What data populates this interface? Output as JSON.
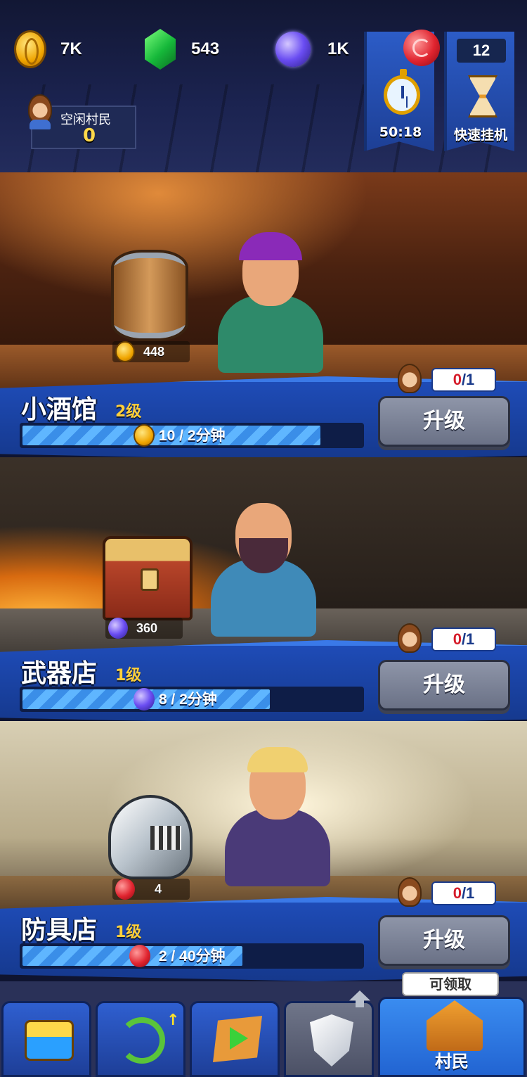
{
  "resources": {
    "gold": "7K",
    "gems": "543",
    "essence": "1K",
    "candy": "12"
  },
  "idle_villagers": {
    "label": "空闲村民",
    "count": "0"
  },
  "timer_button": {
    "label": "50:18",
    "icon": "stopwatch-icon"
  },
  "quick_idle_button": {
    "label": "快速挂机",
    "icon": "hourglass-icon"
  },
  "buildings": [
    {
      "name": "小酒馆",
      "level": "2级",
      "stock": "448",
      "resource": "gold",
      "production": "10 / 2分钟",
      "progress": 0.88,
      "workers_current": "0",
      "workers_max": "/1",
      "upgrade_label": "升级"
    },
    {
      "name": "武器店",
      "level": "1级",
      "stock": "360",
      "resource": "essence",
      "production": "8 / 2分钟",
      "progress": 0.73,
      "workers_current": "0",
      "workers_max": "/1",
      "upgrade_label": "升级"
    },
    {
      "name": "防具店",
      "level": "1级",
      "stock": "4",
      "resource": "candy",
      "production": "2 / 40分钟",
      "progress": 0.65,
      "workers_current": "0",
      "workers_max": "/1",
      "upgrade_label": "升级"
    }
  ],
  "nav": {
    "items": [
      {
        "icon": "treasure-chest-icon"
      },
      {
        "icon": "bow-upgrade-icon"
      },
      {
        "icon": "map-play-icon"
      },
      {
        "icon": "shield-locked-icon"
      },
      {
        "icon": "village-house-icon",
        "label": "村民",
        "active": true
      }
    ],
    "claim_tooltip": "可领取"
  },
  "colors": {
    "accent_blue": "#1f4dba",
    "level_gold": "#ffcf3a",
    "worker_red": "#d51c2a"
  }
}
